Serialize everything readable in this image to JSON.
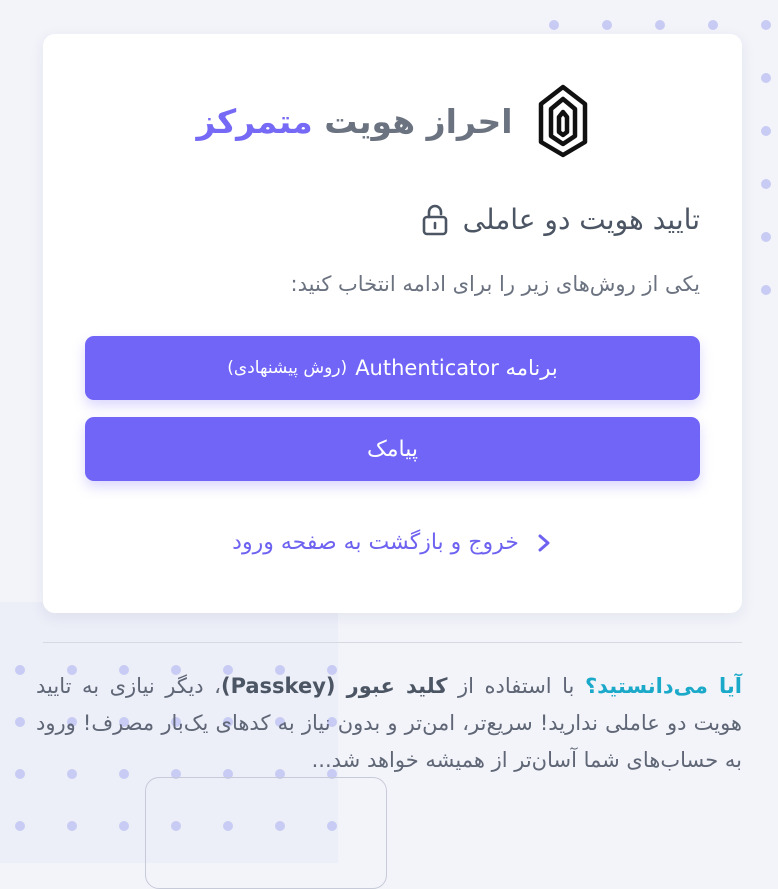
{
  "brand": {
    "title_main": "احراز هویت",
    "title_accent": "متمرکز"
  },
  "auth": {
    "title": "تایید هویت دو عاملی",
    "subtitle": "یکی از روش‌های زیر را برای ادامه انتخاب کنید:",
    "options": [
      {
        "label": "برنامه Authenticator",
        "hint": "(روش پیشنهادی)"
      },
      {
        "label": "پیامک"
      }
    ],
    "back_link": "خروج و بازگشت به صفحه ورود"
  },
  "tip": {
    "heading": "آیا می‌دانستید؟",
    "text_1": " با استفاده از ",
    "keyword": "کلید عبور (Passkey)",
    "text_2": "، دیگر نیازی به تایید هویت دو عاملی ندارید! سریع‌تر، امن‌تر و بدون نیاز به کدهای یک‌بار مصرف! ورود به حساب‌های شما آسان‌تر از همیشه خواهد شد..."
  },
  "colors": {
    "accent": "#7065f7",
    "tip_heading": "#1aa9c9",
    "background": "#f3f4fa"
  },
  "icons": {
    "logo": "building-logo-icon",
    "lock": "lock-icon",
    "chevron": "chevron-right-icon"
  }
}
